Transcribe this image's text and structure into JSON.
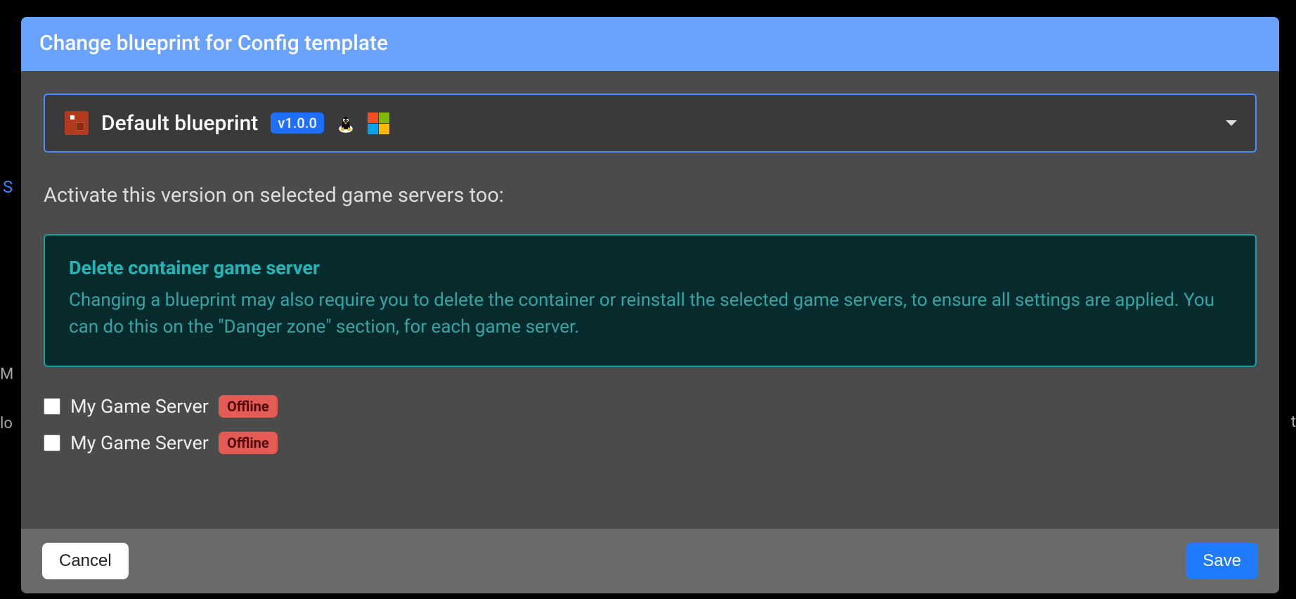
{
  "modal": {
    "title": "Change blueprint for Config template",
    "select": {
      "label": "Default blueprint",
      "version": "v1.0.0",
      "icons": [
        "app-icon",
        "linux-icon",
        "windows-icon"
      ]
    },
    "section_heading": "Activate this version on selected game servers too:",
    "info": {
      "title": "Delete container game server",
      "text": "Changing a blueprint may also require you to delete the container or reinstall the selected game servers, to ensure all settings are applied. You can do this on the \"Danger zone\" section, for each game server."
    },
    "servers": [
      {
        "name": "My Game Server",
        "status": "Offline",
        "checked": false
      },
      {
        "name": "My Game Server",
        "status": "Offline",
        "checked": false
      }
    ],
    "buttons": {
      "cancel": "Cancel",
      "save": "Save"
    }
  },
  "colors": {
    "accent": "#1f7cff",
    "header": "#6aa3ff",
    "info_border": "#1a9e9e",
    "status_offline": "#e45b56"
  }
}
